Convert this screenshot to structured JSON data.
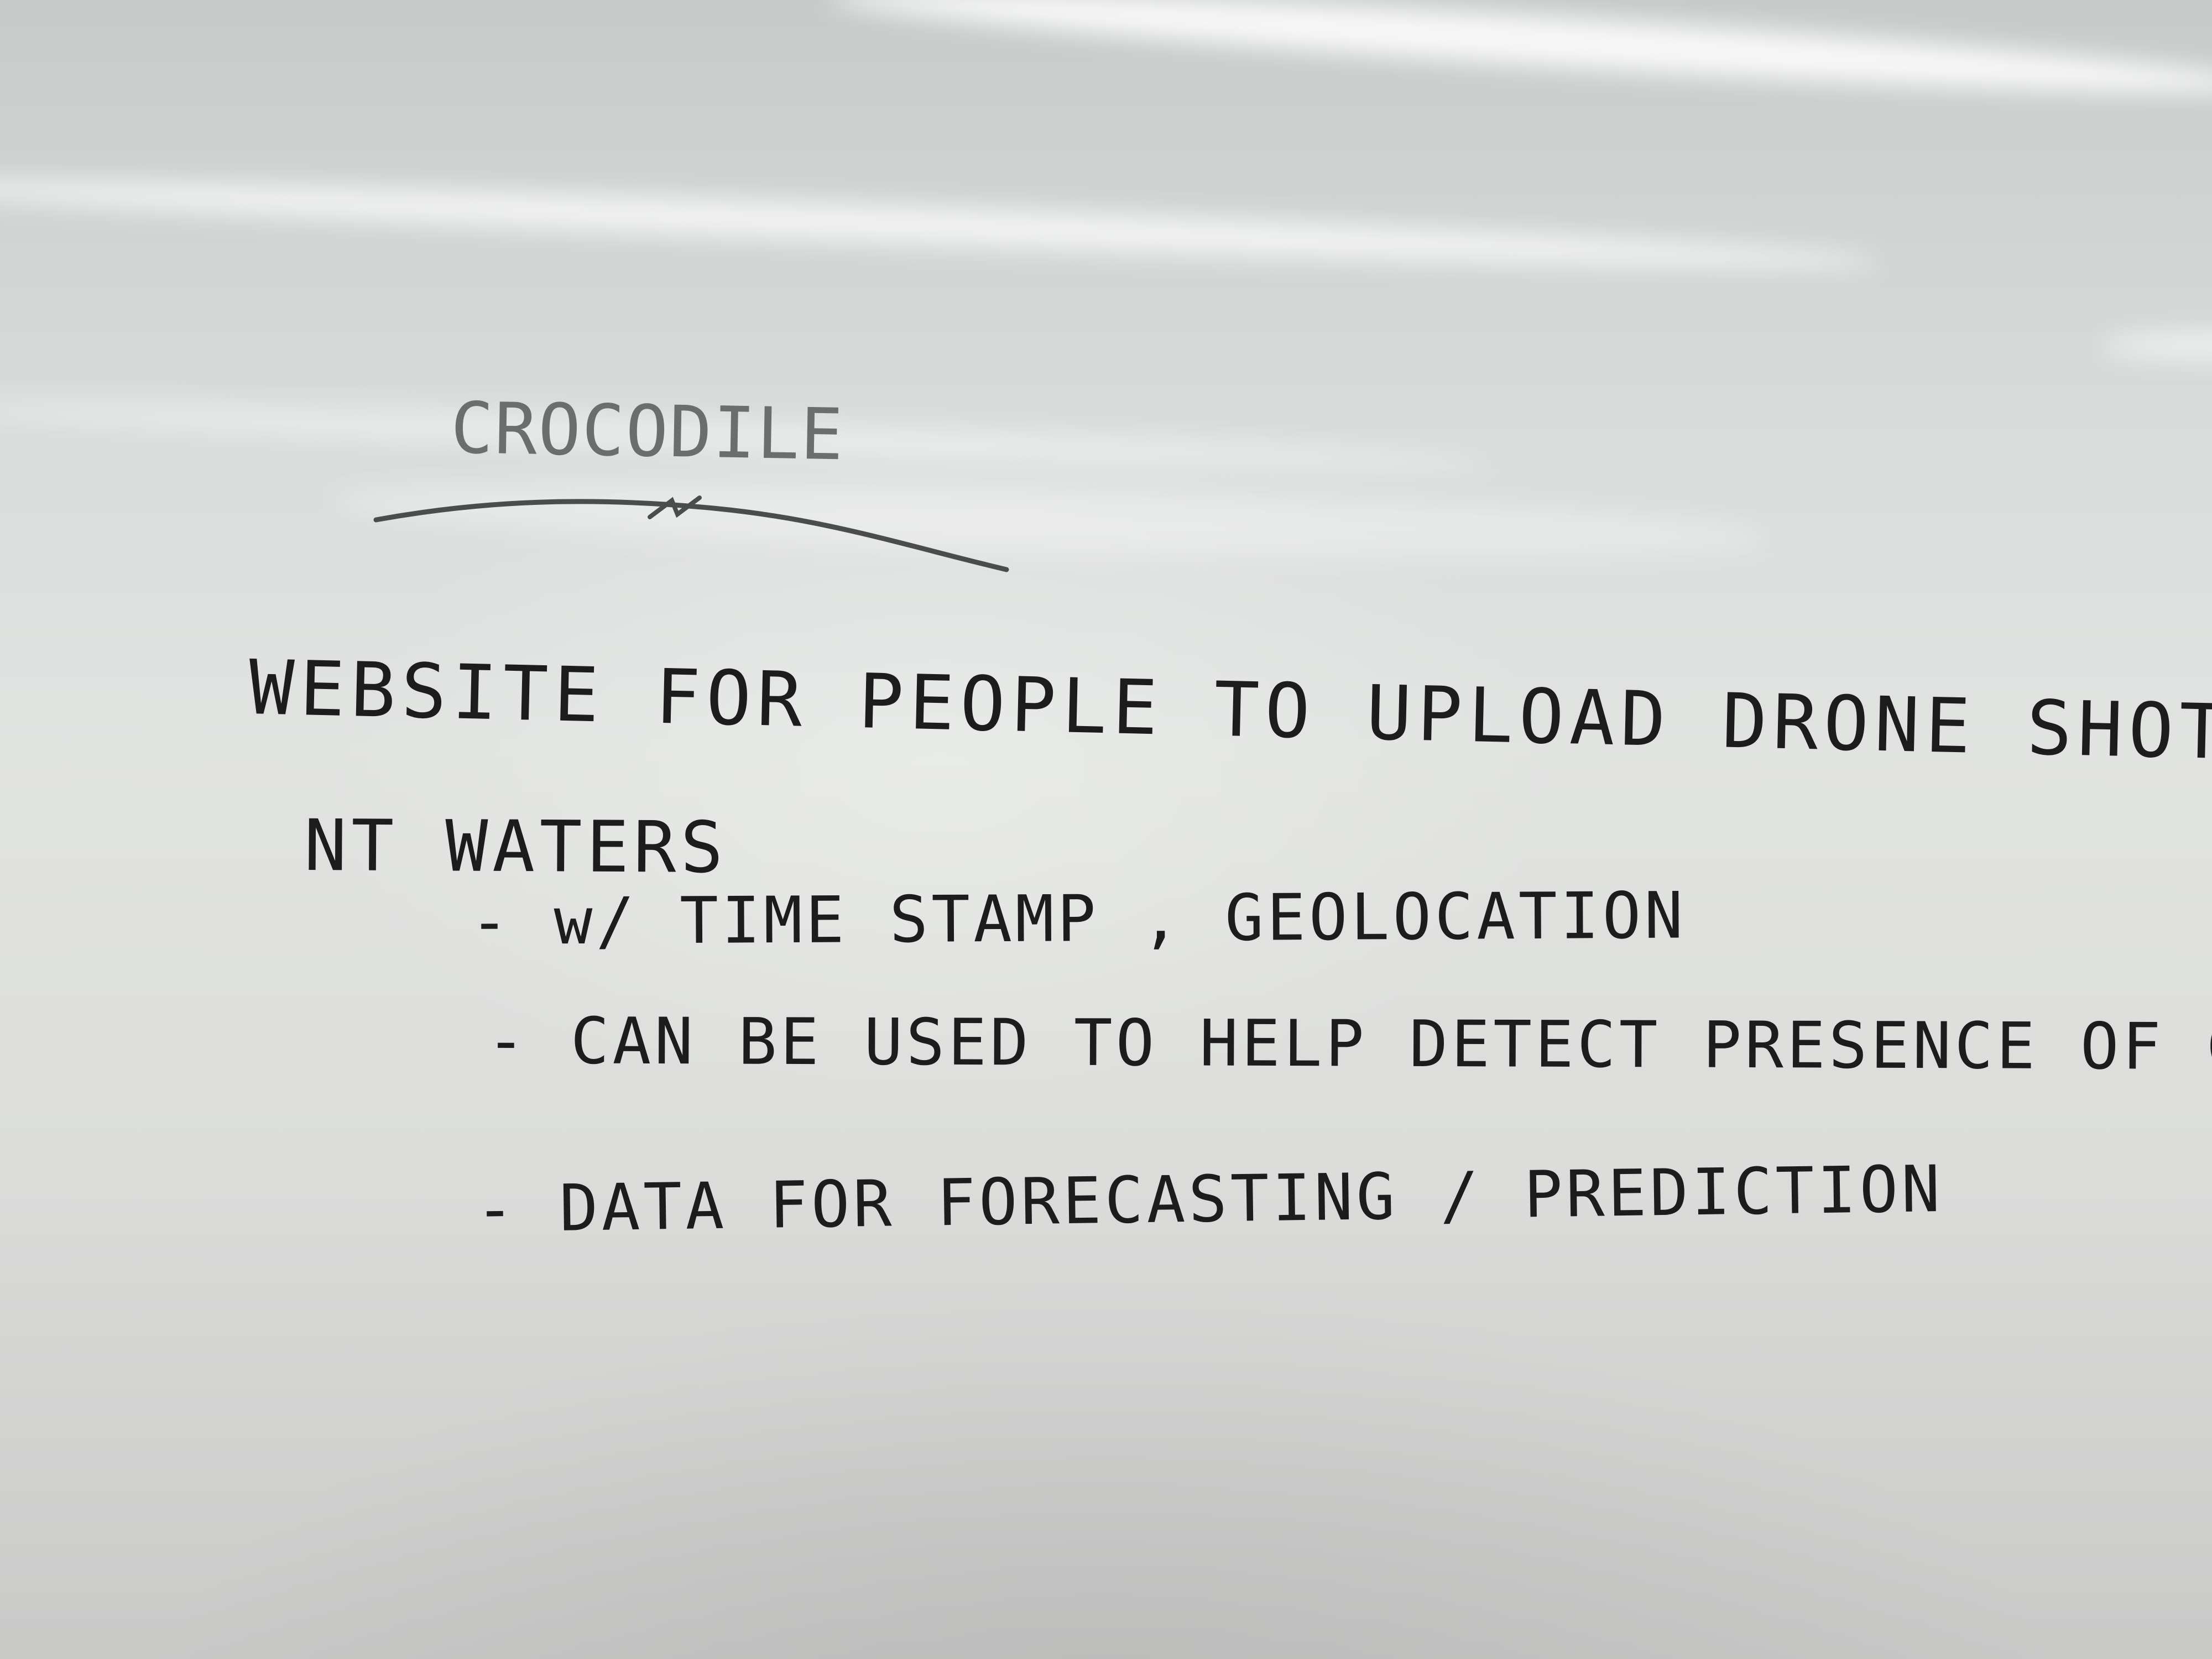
{
  "whiteboard": {
    "title": "CROCODILE",
    "lines": [
      "WEBSITE  FOR  PEOPLE  TO  UPLOAD  DRONE SHOTS  OF",
      "NT  WATERS"
    ],
    "bullets": [
      "-  w/  TIME STAMP ,  GEOLOCATION",
      "-  CAN  BE  USED  TO  HELP  DETECT  PRESENCE  OF  CROCS",
      "-  DATA  FOR  FORECASTING / PREDICTION"
    ]
  },
  "colors": {
    "ink": "#1c1c1c",
    "faded_ink": "#6b6e6d",
    "board": "#dcdfdd"
  }
}
